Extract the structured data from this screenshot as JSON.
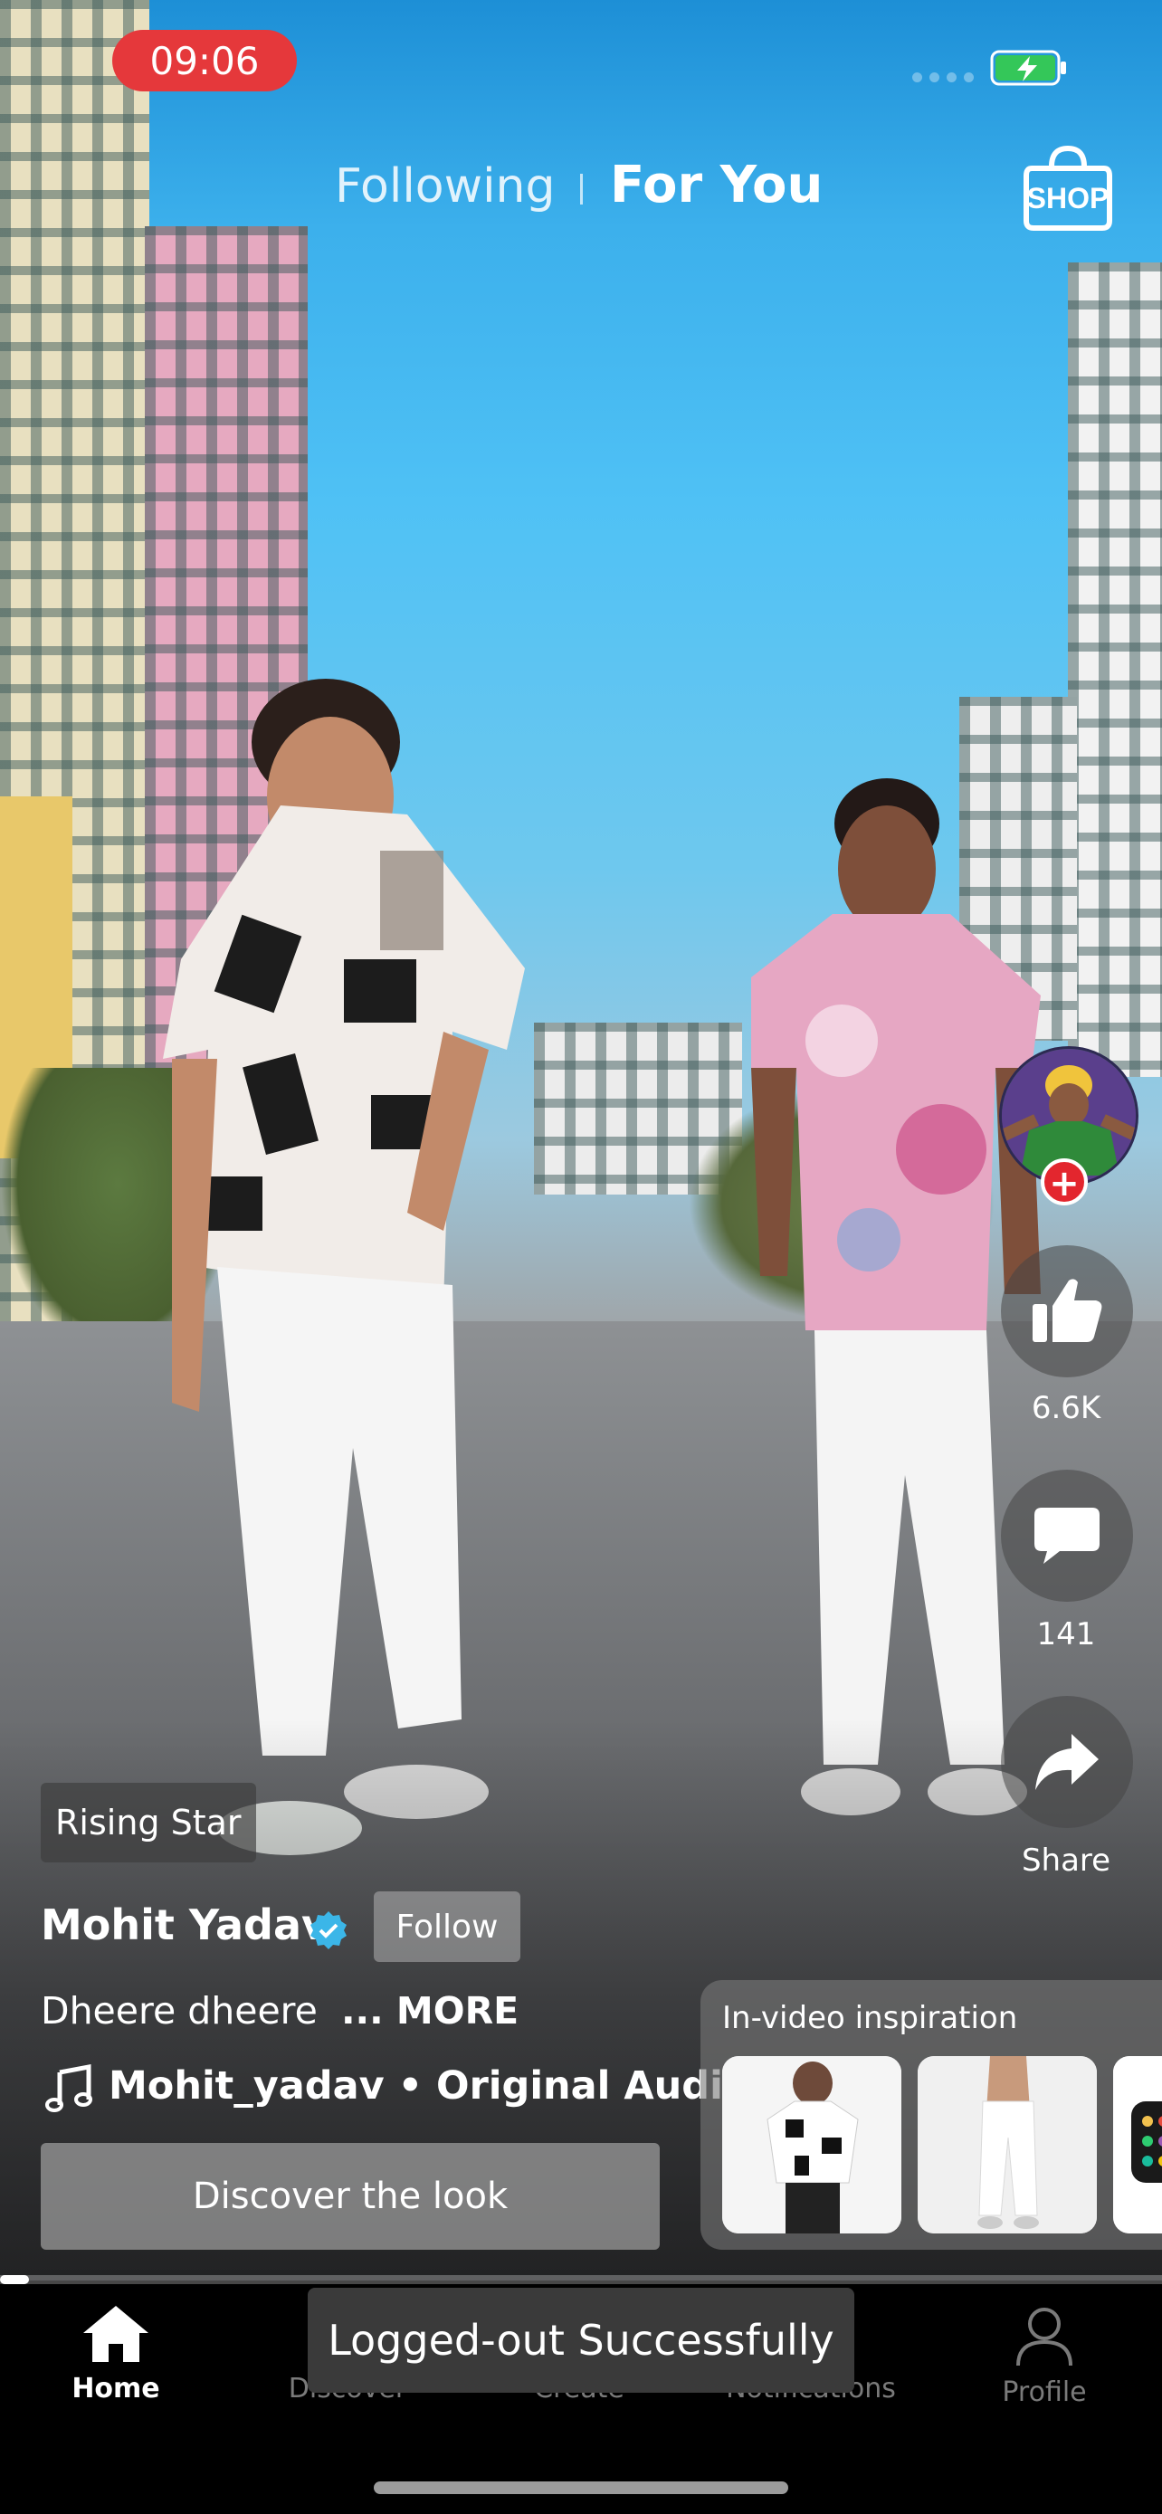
{
  "status_bar": {
    "time": "09:06"
  },
  "header": {
    "tabs": [
      {
        "label": "Following"
      },
      {
        "label": "For You"
      }
    ],
    "shop_label": "SHOP"
  },
  "rail": {
    "likes": "6.6K",
    "comments": "141",
    "share_label": "Share"
  },
  "post": {
    "badge": "Rising Star",
    "creator": "Mohit Yadav",
    "follow_label": "Follow",
    "caption": "Dheere dheere",
    "more_label": "... MORE",
    "audio": "Mohit_yadav • Original Audio",
    "discover_label": "Discover the look"
  },
  "inspiration": {
    "title": "In-video inspiration"
  },
  "progress": 0.025,
  "nav": {
    "items": [
      {
        "label": "Home"
      },
      {
        "label": "Discover"
      },
      {
        "label": "Create"
      },
      {
        "label": "Notifications"
      },
      {
        "label": "Profile"
      }
    ]
  },
  "toast": "Logged-out Successfully",
  "colors": {
    "record_pill": "#e5383b",
    "plus": "#e3262e",
    "verified": "#3bb6e8"
  }
}
